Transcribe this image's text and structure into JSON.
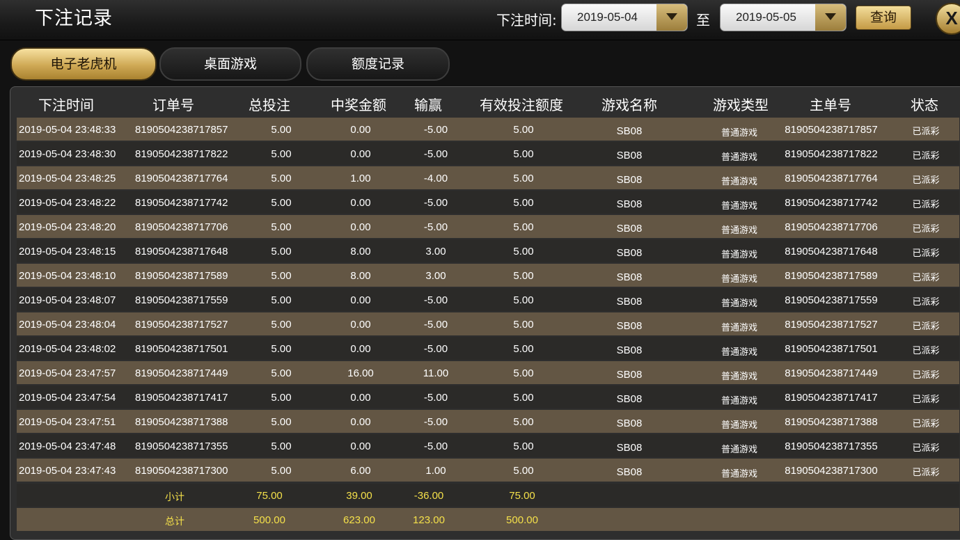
{
  "header": {
    "title": "下注记录",
    "time_label": "下注时间:",
    "start_date": "2019-05-04",
    "to_label": "至",
    "end_date": "2019-05-05",
    "query_label": "查询",
    "close_label": "X"
  },
  "tabs": [
    {
      "label": "电子老虎机",
      "active": true
    },
    {
      "label": "桌面游戏",
      "active": false
    },
    {
      "label": "额度记录",
      "active": false
    }
  ],
  "table": {
    "columns": [
      "下注时间",
      "订单号",
      "总投注",
      "中奖金额",
      "输赢",
      "有效投注额度",
      "游戏名称",
      "游戏类型",
      "主单号",
      "状态"
    ],
    "rows": [
      [
        "2019-05-04 23:48:33",
        "8190504238717857",
        "5.00",
        "0.00",
        "-5.00",
        "5.00",
        "SB08",
        "普通游戏",
        "8190504238717857",
        "已派彩"
      ],
      [
        "2019-05-04 23:48:30",
        "8190504238717822",
        "5.00",
        "0.00",
        "-5.00",
        "5.00",
        "SB08",
        "普通游戏",
        "8190504238717822",
        "已派彩"
      ],
      [
        "2019-05-04 23:48:25",
        "8190504238717764",
        "5.00",
        "1.00",
        "-4.00",
        "5.00",
        "SB08",
        "普通游戏",
        "8190504238717764",
        "已派彩"
      ],
      [
        "2019-05-04 23:48:22",
        "8190504238717742",
        "5.00",
        "0.00",
        "-5.00",
        "5.00",
        "SB08",
        "普通游戏",
        "8190504238717742",
        "已派彩"
      ],
      [
        "2019-05-04 23:48:20",
        "8190504238717706",
        "5.00",
        "0.00",
        "-5.00",
        "5.00",
        "SB08",
        "普通游戏",
        "8190504238717706",
        "已派彩"
      ],
      [
        "2019-05-04 23:48:15",
        "8190504238717648",
        "5.00",
        "8.00",
        "3.00",
        "5.00",
        "SB08",
        "普通游戏",
        "8190504238717648",
        "已派彩"
      ],
      [
        "2019-05-04 23:48:10",
        "8190504238717589",
        "5.00",
        "8.00",
        "3.00",
        "5.00",
        "SB08",
        "普通游戏",
        "8190504238717589",
        "已派彩"
      ],
      [
        "2019-05-04 23:48:07",
        "8190504238717559",
        "5.00",
        "0.00",
        "-5.00",
        "5.00",
        "SB08",
        "普通游戏",
        "8190504238717559",
        "已派彩"
      ],
      [
        "2019-05-04 23:48:04",
        "8190504238717527",
        "5.00",
        "0.00",
        "-5.00",
        "5.00",
        "SB08",
        "普通游戏",
        "8190504238717527",
        "已派彩"
      ],
      [
        "2019-05-04 23:48:02",
        "8190504238717501",
        "5.00",
        "0.00",
        "-5.00",
        "5.00",
        "SB08",
        "普通游戏",
        "8190504238717501",
        "已派彩"
      ],
      [
        "2019-05-04 23:47:57",
        "8190504238717449",
        "5.00",
        "16.00",
        "11.00",
        "5.00",
        "SB08",
        "普通游戏",
        "8190504238717449",
        "已派彩"
      ],
      [
        "2019-05-04 23:47:54",
        "8190504238717417",
        "5.00",
        "0.00",
        "-5.00",
        "5.00",
        "SB08",
        "普通游戏",
        "8190504238717417",
        "已派彩"
      ],
      [
        "2019-05-04 23:47:51",
        "8190504238717388",
        "5.00",
        "0.00",
        "-5.00",
        "5.00",
        "SB08",
        "普通游戏",
        "8190504238717388",
        "已派彩"
      ],
      [
        "2019-05-04 23:47:48",
        "8190504238717355",
        "5.00",
        "0.00",
        "-5.00",
        "5.00",
        "SB08",
        "普通游戏",
        "8190504238717355",
        "已派彩"
      ],
      [
        "2019-05-04 23:47:43",
        "8190504238717300",
        "5.00",
        "6.00",
        "1.00",
        "5.00",
        "SB08",
        "普通游戏",
        "8190504238717300",
        "已派彩"
      ]
    ],
    "subtotal": {
      "label": "小计",
      "total_bet": "75.00",
      "win": "39.00",
      "net": "-36.00",
      "valid_bet": "75.00"
    },
    "total": {
      "label": "总计",
      "total_bet": "500.00",
      "win": "623.00",
      "net": "123.00",
      "valid_bet": "500.00"
    }
  }
}
